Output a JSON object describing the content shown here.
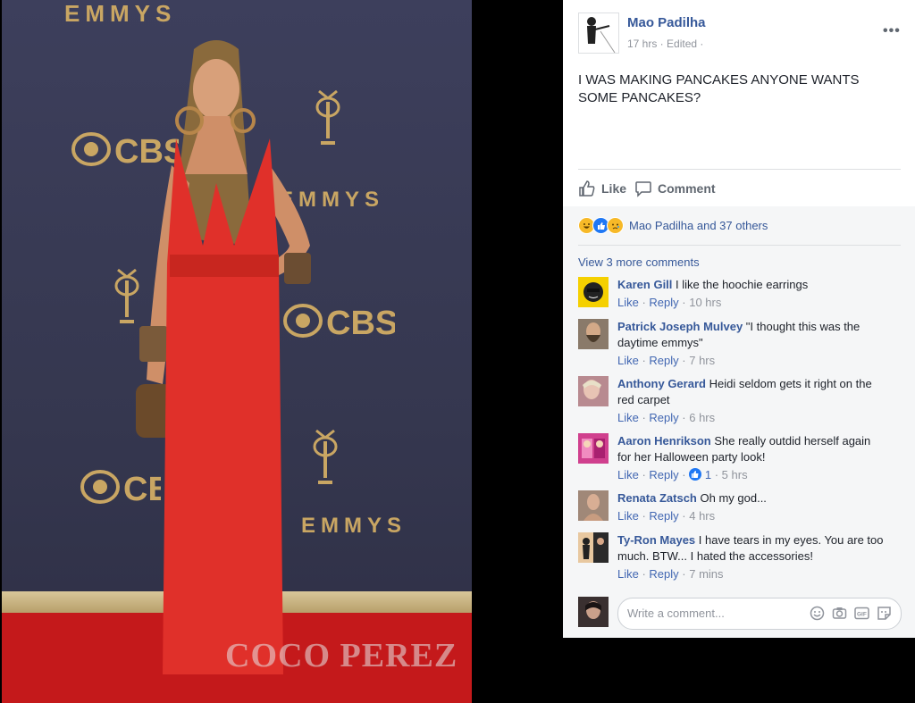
{
  "photo": {
    "backdrop_texts": [
      "EMMYS",
      "EMMYS",
      "EMMYS",
      "CBS",
      "CBS",
      "CBS"
    ],
    "watermark": "COCO PEREZ"
  },
  "post": {
    "author": "Mao Padilha",
    "meta": "17 hrs · Edited ·",
    "text": "I WAS MAKING PANCAKES ANYONE WANTS SOME PANCAKES?",
    "more_label": "•••"
  },
  "actions": {
    "like_label": "Like",
    "comment_label": "Comment"
  },
  "reactions": {
    "icons": [
      "haha-icon",
      "like-icon",
      "sad-icon"
    ],
    "summary": "Mao Padilha and 37 others"
  },
  "comments_section": {
    "view_more": "View 3 more comments",
    "comments": [
      {
        "name": "Karen Gill",
        "text": "I like the hoochie earrings",
        "like": "Like",
        "reply": "Reply",
        "reactions": "",
        "time": "10 hrs"
      },
      {
        "name": "Patrick Joseph Mulvey",
        "text": "\"I thought this was the daytime emmys\"",
        "like": "Like",
        "reply": "Reply",
        "reactions": "",
        "time": "7 hrs"
      },
      {
        "name": "Anthony Gerard",
        "text": "Heidi seldom gets it right on the red carpet",
        "like": "Like",
        "reply": "Reply",
        "reactions": "",
        "time": "6 hrs"
      },
      {
        "name": "Aaron Henrikson",
        "text": "She really outdid herself again for her Halloween party look!",
        "like": "Like",
        "reply": "Reply",
        "reactions": "1",
        "time": "5 hrs"
      },
      {
        "name": "Renata Zatsch",
        "text": "Oh my god...",
        "like": "Like",
        "reply": "Reply",
        "reactions": "",
        "time": "4 hrs"
      },
      {
        "name": "Ty-Ron Mayes",
        "text": "I have tears in my eyes. You are too much. BTW... I hated the accessories!",
        "like": "Like",
        "reply": "Reply",
        "reactions": "",
        "time": "7 mins"
      }
    ]
  },
  "composer": {
    "placeholder": "Write a comment...",
    "icons": [
      "emoji-icon",
      "camera-icon",
      "gif-icon",
      "sticker-icon"
    ]
  },
  "colors": {
    "link_blue": "#365899",
    "dress_red": "#e0302a",
    "carpet_red": "#c4191b",
    "backdrop": "#3d3f5c",
    "gold": "#c9a663"
  }
}
